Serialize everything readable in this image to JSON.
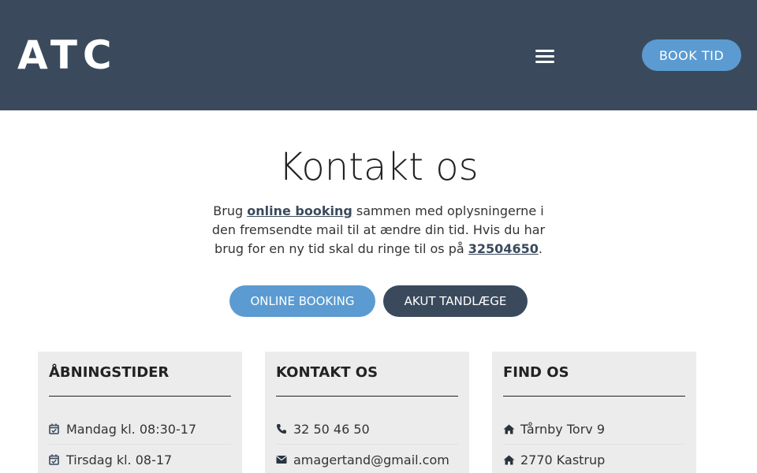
{
  "header": {
    "logo": "ATC",
    "book_label": "BOOK TID",
    "bg_color": "#3a4a5c",
    "accent_color": "#5b9bd1"
  },
  "main": {
    "title": "Kontakt os",
    "intro_before": "Brug ",
    "intro_link": "online booking",
    "intro_mid": " sammen med oplysningerne i den fremsendte mail til at ændre din tid. Hvis du har brug for en ny tid skal du ringe til os på  ",
    "intro_phone": "32504650",
    "intro_after": ".",
    "online_booking_label": "ONLINE BOOKING",
    "akut_label": "AKUT TANDLÆGE"
  },
  "cards": {
    "hours": {
      "title": "ÅBNINGSTIDER",
      "items": [
        "Mandag kl. 08:30-17",
        "Tirsdag kl. 08-17"
      ]
    },
    "contact": {
      "title": "KONTAKT OS",
      "phone": "32 50 46 50",
      "email": "amagertand@gmail.com"
    },
    "find": {
      "title": "FIND OS",
      "address": "Tårnby Torv 9",
      "city": "2770 Kastrup"
    }
  },
  "icons": {
    "menu": "hamburger-icon",
    "hours": "calendar-check-icon",
    "phone": "phone-icon",
    "email": "envelope-icon",
    "address": "home-icon"
  }
}
